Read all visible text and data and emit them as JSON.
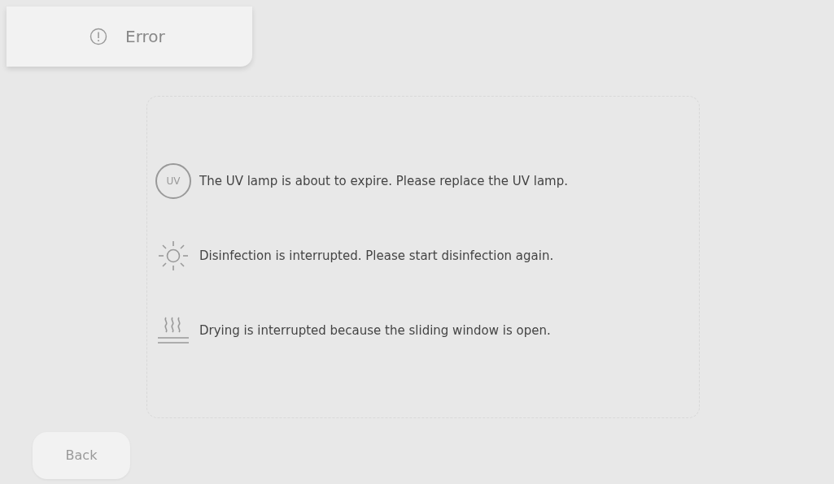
{
  "header": {
    "title": "Error"
  },
  "messages": [
    {
      "kind": "uv",
      "icon_text": "UV",
      "text": "The UV lamp is about to expire. Please replace the UV lamp."
    },
    {
      "kind": "disinfection",
      "text": "Disinfection is interrupted. Please start disinfection again."
    },
    {
      "kind": "drying",
      "text": "Drying is interrupted because the sliding window is open."
    }
  ],
  "buttons": [
    {
      "label": "Back"
    }
  ]
}
